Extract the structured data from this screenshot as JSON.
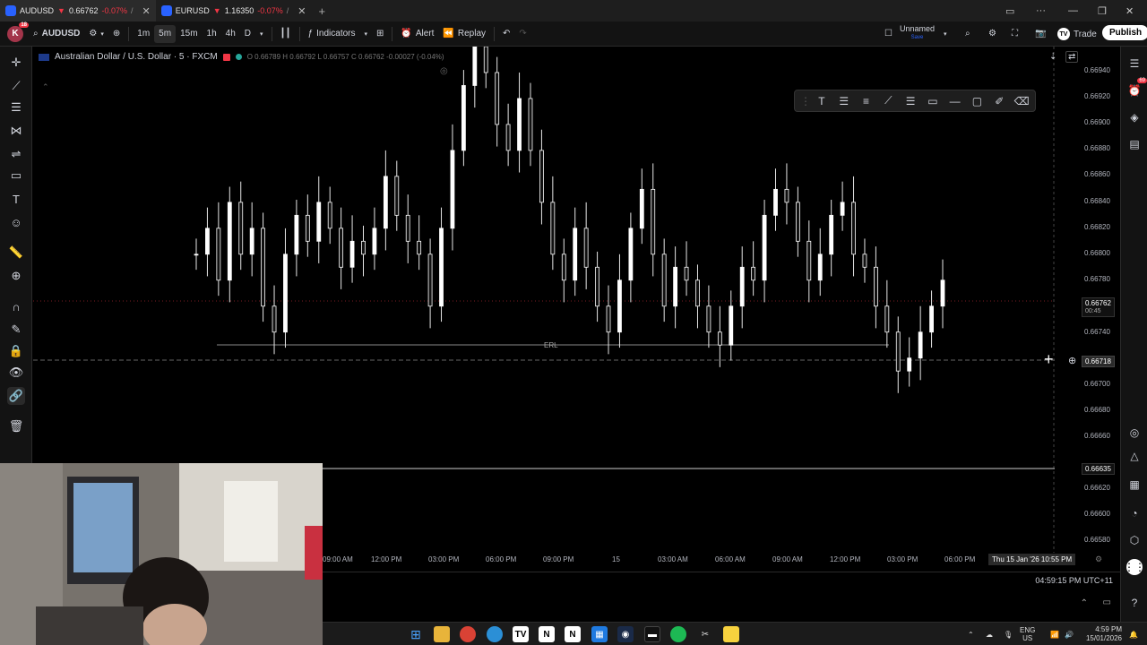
{
  "browser": {
    "tabs": [
      {
        "symbol": "AUDUSD",
        "arrow": "▼",
        "price": "0.66762",
        "change": "-0.07%",
        "extra": "/"
      },
      {
        "symbol": "EURUSD",
        "arrow": "▼",
        "price": "1.16350",
        "change": "-0.07%",
        "extra": "/"
      }
    ],
    "new_tab": "+"
  },
  "toolbar": {
    "avatar_letter": "K",
    "avatar_badge": "18",
    "symbol": "AUDUSD",
    "intervals": [
      "1m",
      "5m",
      "15m",
      "1h",
      "4h",
      "D"
    ],
    "selected_interval": "5m",
    "indicators": "Indicators",
    "alert": "Alert",
    "replay": "Replay",
    "layout_name": "Unnamed",
    "layout_status": "Save",
    "trade": "Trade",
    "publish": "Publish"
  },
  "legend": {
    "title": "Australian Dollar / U.S. Dollar · 5 · FXCM",
    "ohlc": "O 0.66789  H 0.66792  L 0.66757  C 0.66762  -0.00027 (-0.04%)"
  },
  "chart_data": {
    "type": "candlestick",
    "symbol": "AUDUSD",
    "interval": "5",
    "ylim": [
      0.6657,
      0.6696
    ],
    "y_ticks": [
      "0.66940",
      "0.66920",
      "0.66900",
      "0.66880",
      "0.66860",
      "0.66840",
      "0.66820",
      "0.66800",
      "0.66780",
      "0.66740",
      "0.66700",
      "0.66680",
      "0.66660",
      "0.66620",
      "0.66600",
      "0.66580"
    ],
    "x_ticks": [
      "09:00 AM",
      "12:00 PM",
      "03:00 PM",
      "06:00 PM",
      "09:00 PM",
      "15",
      "03:00 AM",
      "06:00 AM",
      "09:00 AM",
      "12:00 PM",
      "03:00 PM",
      "06:00 PM"
    ],
    "series_close": [
      0.668,
      0.6682,
      0.6678,
      0.6684,
      0.668,
      0.6682,
      0.6676,
      0.6674,
      0.668,
      0.6683,
      0.6681,
      0.6684,
      0.6682,
      0.6679,
      0.6681,
      0.668,
      0.6682,
      0.6686,
      0.6683,
      0.6681,
      0.668,
      0.6676,
      0.6682,
      0.6688,
      0.6693,
      0.6696,
      0.6694,
      0.669,
      0.6688,
      0.6692,
      0.6688,
      0.6684,
      0.668,
      0.6678,
      0.6682,
      0.6679,
      0.6676,
      0.6674,
      0.6678,
      0.6682,
      0.6685,
      0.668,
      0.6676,
      0.6679,
      0.6678,
      0.6676,
      0.6674,
      0.6673,
      0.6676,
      0.6679,
      0.6678,
      0.6683,
      0.6685,
      0.6684,
      0.6681,
      0.6678,
      0.668,
      0.6683,
      0.6684,
      0.668,
      0.6679,
      0.6676,
      0.6674,
      0.6671,
      0.6672,
      0.6674,
      0.6676,
      0.6678
    ],
    "current_price": "0.66762",
    "countdown": "00:45",
    "crosshair_price": "0.66718",
    "line_price": "0.66635",
    "erl_label": "ERL",
    "crosshair_time": "Thu 15 Jan '26   10:55 PM"
  },
  "clock": "04:59:15 PM UTC+11",
  "taskbar": {
    "lang": "ENG",
    "region": "US",
    "time": "4:59 PM",
    "date": "15/01/2026"
  },
  "colors": {
    "bg": "#000000",
    "accent": "#2962ff",
    "down": "#f23645",
    "up": "#26a69a"
  }
}
